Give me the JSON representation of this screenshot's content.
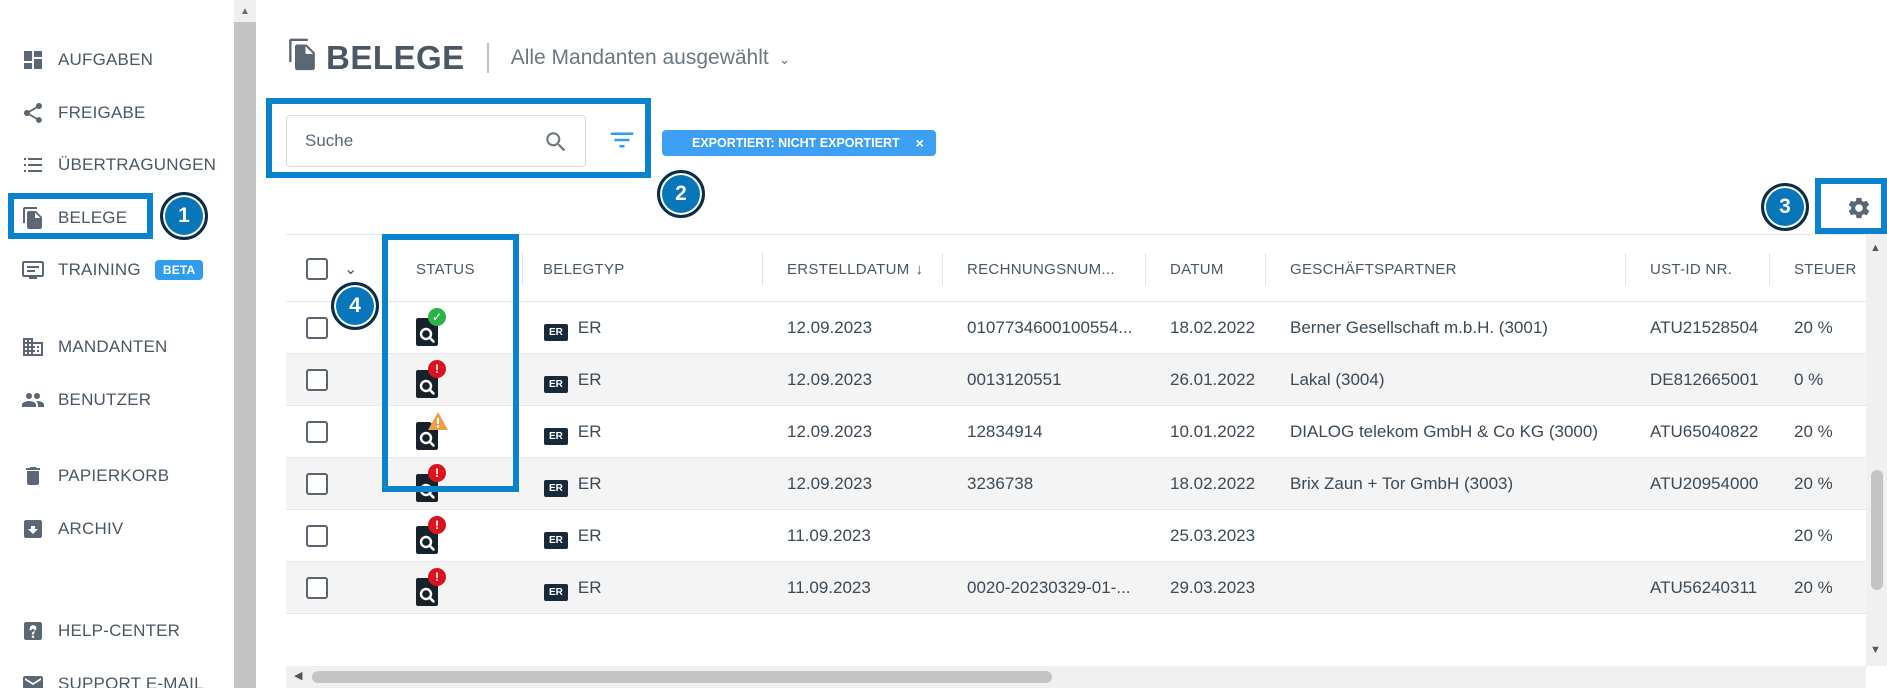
{
  "sidebar": {
    "items": [
      {
        "label": "AUFGABEN",
        "icon": "dashboard-icon"
      },
      {
        "label": "FREIGABE",
        "icon": "share-icon"
      },
      {
        "label": "ÜBERTRAGUNGEN",
        "icon": "list-icon"
      },
      {
        "label": "BELEGE",
        "icon": "documents-icon"
      },
      {
        "label": "TRAINING",
        "icon": "training-icon",
        "badge": "BETA"
      },
      {
        "label": "MANDANTEN",
        "icon": "building-icon"
      },
      {
        "label": "BENUTZER",
        "icon": "users-icon"
      },
      {
        "label": "PAPIERKORB",
        "icon": "trash-icon"
      },
      {
        "label": "ARCHIV",
        "icon": "archive-icon"
      },
      {
        "label": "HELP-CENTER",
        "icon": "help-icon"
      },
      {
        "label": "SUPPORT E-MAIL",
        "icon": "mail-icon"
      }
    ]
  },
  "header": {
    "title": "BELEGE",
    "mandant_selector": "Alle Mandanten ausgewählt"
  },
  "search": {
    "placeholder": "Suche"
  },
  "filter_chip": {
    "label": "EXPORTIERT: NICHT EXPORTIERT",
    "remove": "×"
  },
  "annotations": [
    "1",
    "2",
    "3",
    "4"
  ],
  "table": {
    "columns": [
      "STATUS",
      "BELEGTYP",
      "ERSTELLDATUM",
      "RECHNUNGSNUM...",
      "DATUM",
      "GESCHÄFTSPARTNER",
      "UST-ID NR.",
      "STEUER"
    ],
    "rows": [
      {
        "status": "ok",
        "typ_tag": "ER",
        "typ": "ER",
        "erstelldatum": "12.09.2023",
        "rechnungsnr": "0107734600100554...",
        "datum": "18.02.2022",
        "partner": "Berner Gesellschaft m.b.H. (3001)",
        "ustid": "ATU21528504",
        "steuer": "20 %"
      },
      {
        "status": "error",
        "typ_tag": "ER",
        "typ": "ER",
        "erstelldatum": "12.09.2023",
        "rechnungsnr": "0013120551",
        "datum": "26.01.2022",
        "partner": "Lakal (3004)",
        "ustid": "DE812665001",
        "steuer": "0 %"
      },
      {
        "status": "warning",
        "typ_tag": "ER",
        "typ": "ER",
        "erstelldatum": "12.09.2023",
        "rechnungsnr": "12834914",
        "datum": "10.01.2022",
        "partner": "DIALOG telekom GmbH & Co KG (3000)",
        "ustid": "ATU65040822",
        "steuer": "20 %"
      },
      {
        "status": "error",
        "typ_tag": "ER",
        "typ": "ER",
        "erstelldatum": "12.09.2023",
        "rechnungsnr": "3236738",
        "datum": "18.02.2022",
        "partner": "Brix Zaun + Tor GmbH (3003)",
        "ustid": "ATU20954000",
        "steuer": "20 %"
      },
      {
        "status": "error",
        "typ_tag": "ER",
        "typ": "ER",
        "erstelldatum": "11.09.2023",
        "rechnungsnr": "",
        "datum": "25.03.2023",
        "partner": "",
        "ustid": "",
        "steuer": "20 %"
      },
      {
        "status": "error",
        "typ_tag": "ER",
        "typ": "ER",
        "erstelldatum": "11.09.2023",
        "rechnungsnr": "0020-20230329-01-...",
        "datum": "29.03.2023",
        "partner": "",
        "ustid": "ATU56240311",
        "steuer": "20 %"
      }
    ]
  },
  "colors": {
    "accent": "#0a83cc",
    "chip": "#3ea0f5",
    "ok": "#2db34a",
    "error": "#d9141e",
    "warning": "#f0a04b"
  }
}
